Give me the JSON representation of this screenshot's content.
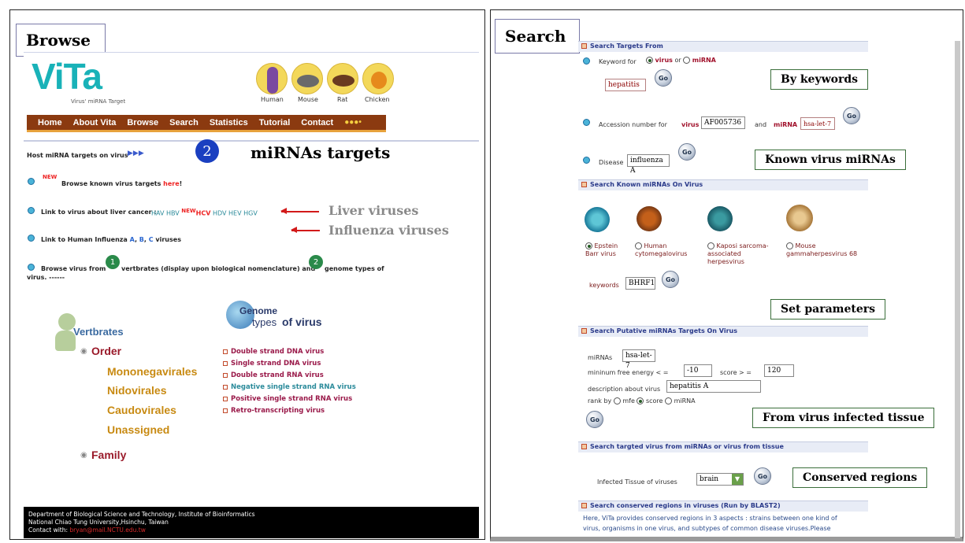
{
  "browse": {
    "title": "Browse",
    "logo_text": "ViTa",
    "logo_sub": "Virus' miRNA Target",
    "species": [
      "Human",
      "Mouse",
      "Rat",
      "Chicken"
    ],
    "nav": [
      "Home",
      "About Vita",
      "Browse",
      "Search",
      "Statistics",
      "Tutorial",
      "Contact"
    ],
    "nav_more": "●●●•",
    "host_line": "Host miRNA targets on virus",
    "badge_num": "2",
    "mirna_targets": "miRNAs targets",
    "new_tag": "NEW",
    "known_line": "Browse known virus targets",
    "known_link": "here",
    "known_end": "!",
    "liver_line": "Link to virus about liver cancer :",
    "liver_viruses": [
      "HAV",
      "HBV",
      "HCV",
      "HDV",
      "HEV",
      "HGV"
    ],
    "liver_annot": "Liver viruses",
    "influenza_line": "Link to Human Influenza",
    "influenza_types": [
      "A",
      "B",
      "C"
    ],
    "influenza_end": "viruses",
    "influenza_annot": "Influenza viruses",
    "browse_from": "Browse virus from",
    "num_1": "1",
    "vert_desc": "vertbrates (display upon biological nomenclature) and",
    "num_2": "2",
    "genome_desc": "genome types of",
    "virus_line": "virus. ------",
    "vertbrates_label": "Vertbrates",
    "order_label": "Order",
    "orders": [
      "Mononegavirales",
      "Nidovirales",
      "Caudovirales",
      "Unassigned"
    ],
    "family_label": "Family",
    "genome_big": "Genome",
    "genome_sub_1": "types",
    "genome_sub_2": "of virus",
    "genome_types": [
      "Double strand DNA virus",
      "Single strand DNA virus",
      "Double strand RNA virus",
      "Negative single strand RNA virus",
      "Positive single strand RNA virus",
      "Retro-transcripting virus"
    ],
    "footer_line1": "Department of Biological Science and Technology, Institute of Bioinformatics",
    "footer_line2": "National Chiao Tung University,Hsinchu, Taiwan",
    "footer_contact_label": "Contact with:",
    "footer_contact_email": "bryan@mail.NCTU.edu.tw"
  },
  "search": {
    "title": "Search",
    "sec1": "Search Targets From",
    "keyword_for": "Keyword for",
    "virus_opt": "virus",
    "or": "or",
    "mirna_opt": "miRNA",
    "keyword_value": "hepatitis",
    "go": "Go",
    "accession_label": "Accession number for",
    "acc_virus_label": "virus",
    "acc_virus_value": "AF005736",
    "and": "and",
    "acc_mirna_label": "miRNA",
    "acc_mirna_value": "hsa-let-7",
    "disease_label": "Disease",
    "disease_value": "influenza A",
    "callout_keywords": "By keywords",
    "callout_known": "Known virus miRNAs",
    "sec2": "Search Known miRNAs On Virus",
    "known_viruses": [
      {
        "name": "Epstein Barr virus",
        "selected": true
      },
      {
        "name": "Human cytomegalovirus",
        "selected": false
      },
      {
        "name": "Kaposi sarcoma-associated herpesvirus",
        "selected": false
      },
      {
        "name": "Mouse gammaherpesvirus 68",
        "selected": false
      }
    ],
    "known_keywords_label": "keywords",
    "known_keywords_value": "BHRF1",
    "callout_params": "Set parameters",
    "sec3": "Search Putative miRNAs Targets On Virus",
    "mirnas_label": "miRNAs",
    "mirnas_value": "hsa-let-7",
    "mfe_label": "mininum free energy < =",
    "mfe_value": "-10",
    "score_label": "score > =",
    "score_value": "120",
    "desc_label": "description about virus",
    "desc_value": "hepatitis A",
    "rank_label": "rank by",
    "rank_opts": [
      {
        "label": "mfe",
        "selected": false
      },
      {
        "label": "score",
        "selected": true
      },
      {
        "label": "miRNA",
        "selected": false
      }
    ],
    "callout_tissue": "From virus infected tissue",
    "sec4": "Search targted virus from miRNAs or virus from tissue",
    "tissue_label": "Infected Tissue of viruses",
    "tissue_value": "brain",
    "callout_conserved": "Conserved regions",
    "sec5": "Search conserved regions in viruses (Run by BLAST2)",
    "conserved_text_1": "Here, ViTa provides conserved regions in 3 aspects : strains between one kind of",
    "conserved_text_2": "virus, organisms in one virus, and subtypes of common disease viruses.Please"
  }
}
